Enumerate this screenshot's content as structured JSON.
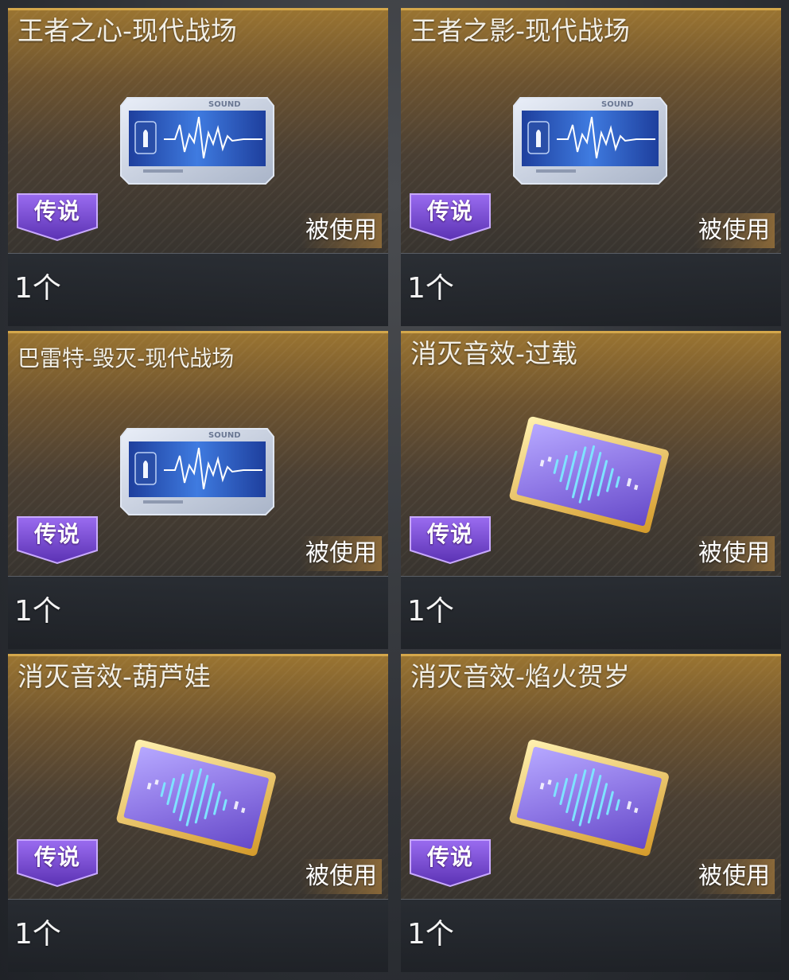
{
  "items": [
    {
      "title": "王者之心-现代战场",
      "badge": "传说",
      "status": "被使用",
      "count": "1个",
      "art": "sound-card-icon"
    },
    {
      "title": "王者之影-现代战场",
      "badge": "传说",
      "status": "被使用",
      "count": "1个",
      "art": "sound-card-icon"
    },
    {
      "title": "巴雷特-毁灭-现代战场",
      "badge": "传说",
      "status": "被使用",
      "count": "1个",
      "art": "sound-card-icon"
    },
    {
      "title": "消灭音效-过载",
      "badge": "传说",
      "status": "被使用",
      "count": "1个",
      "art": "kill-sound-card-icon"
    },
    {
      "title": "消灭音效-葫芦娃",
      "badge": "传说",
      "status": "被使用",
      "count": "1个",
      "art": "kill-sound-card-icon"
    },
    {
      "title": "消灭音效-焰火贺岁",
      "badge": "传说",
      "status": "被使用",
      "count": "1个",
      "art": "kill-sound-card-icon"
    }
  ],
  "sound_card": {
    "header_text": "SOUND"
  },
  "colors": {
    "card_gold": "#d4a74b",
    "badge_purple": "#7b4fd1",
    "sound_blue": "#2f67d6",
    "kill_card_purple": "#8f78e6"
  }
}
